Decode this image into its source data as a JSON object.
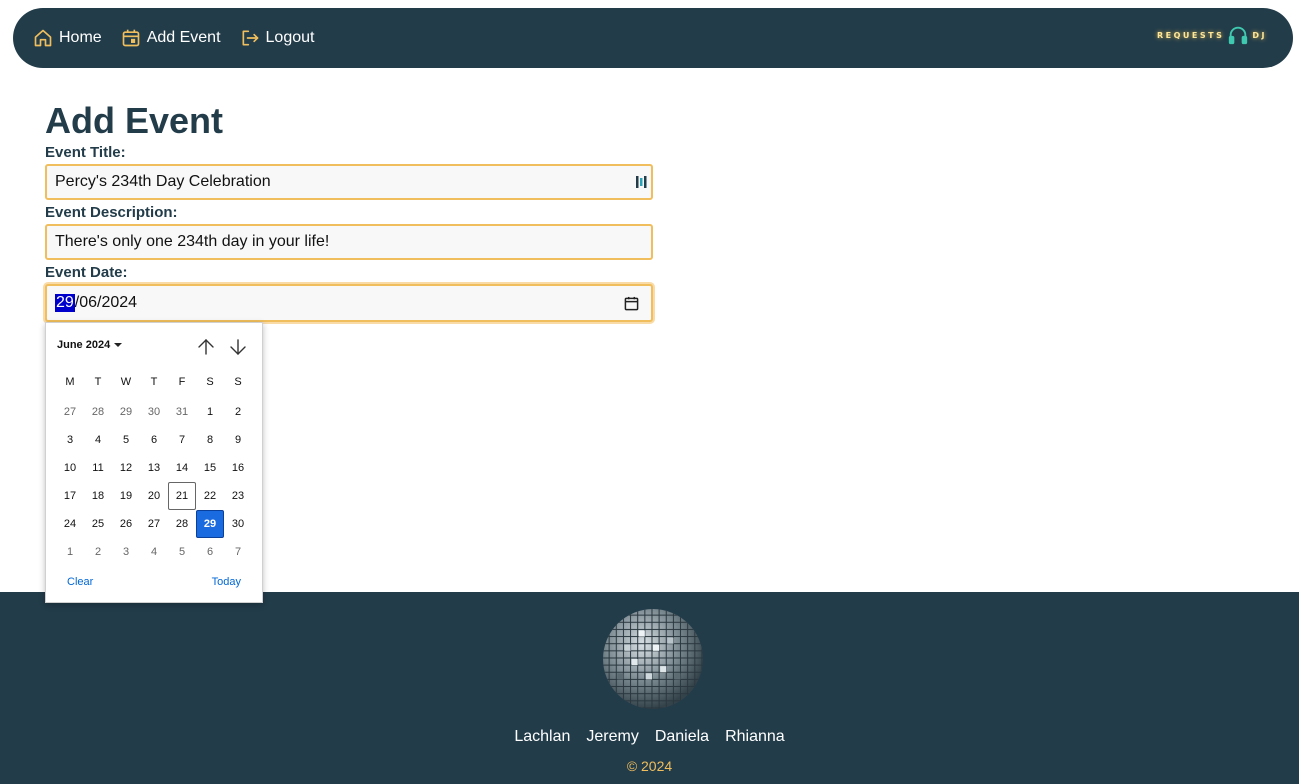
{
  "nav": {
    "items": [
      {
        "label": "Home",
        "icon": "home-icon"
      },
      {
        "label": "Add Event",
        "icon": "calendar-icon"
      },
      {
        "label": "Logout",
        "icon": "logout-icon"
      }
    ],
    "brand_left": "REQUESTS",
    "brand_right": "DJ",
    "brand_icon": "headphones-icon"
  },
  "main": {
    "title": "Add Event",
    "title_label": "Event Title:",
    "title_value": "Percy's 234th Day Celebration",
    "description_label": "Event Description:",
    "description_value": "There's only one 234th day in your life!",
    "date_label": "Event Date:",
    "date_day": "29",
    "date_rest": "/06/2024"
  },
  "picker": {
    "month_label": "June 2024",
    "weekdays": [
      "M",
      "T",
      "W",
      "T",
      "F",
      "S",
      "S"
    ],
    "days": [
      {
        "d": "27",
        "m": true
      },
      {
        "d": "28",
        "m": true
      },
      {
        "d": "29",
        "m": true
      },
      {
        "d": "30",
        "m": true
      },
      {
        "d": "31",
        "m": true
      },
      {
        "d": "1"
      },
      {
        "d": "2"
      },
      {
        "d": "3"
      },
      {
        "d": "4"
      },
      {
        "d": "5"
      },
      {
        "d": "6"
      },
      {
        "d": "7"
      },
      {
        "d": "8"
      },
      {
        "d": "9"
      },
      {
        "d": "10"
      },
      {
        "d": "11"
      },
      {
        "d": "12"
      },
      {
        "d": "13"
      },
      {
        "d": "14"
      },
      {
        "d": "15"
      },
      {
        "d": "16"
      },
      {
        "d": "17"
      },
      {
        "d": "18"
      },
      {
        "d": "19"
      },
      {
        "d": "20"
      },
      {
        "d": "21",
        "today": true
      },
      {
        "d": "22"
      },
      {
        "d": "23"
      },
      {
        "d": "24"
      },
      {
        "d": "25"
      },
      {
        "d": "26"
      },
      {
        "d": "27"
      },
      {
        "d": "28"
      },
      {
        "d": "29",
        "selected": true
      },
      {
        "d": "30"
      },
      {
        "d": "1",
        "m": true
      },
      {
        "d": "2",
        "m": true
      },
      {
        "d": "3",
        "m": true
      },
      {
        "d": "4",
        "m": true
      },
      {
        "d": "5",
        "m": true
      },
      {
        "d": "6",
        "m": true
      },
      {
        "d": "7",
        "m": true
      }
    ],
    "clear_label": "Clear",
    "today_label": "Today"
  },
  "footer": {
    "names": [
      "Lachlan",
      "Jeremy",
      "Daniela",
      "Rhianna"
    ],
    "copyright": "© 2024"
  },
  "colors": {
    "navy": "#223c4a",
    "accent": "#f0be5c",
    "selected": "#1a6ae0",
    "link": "#0067d6"
  }
}
